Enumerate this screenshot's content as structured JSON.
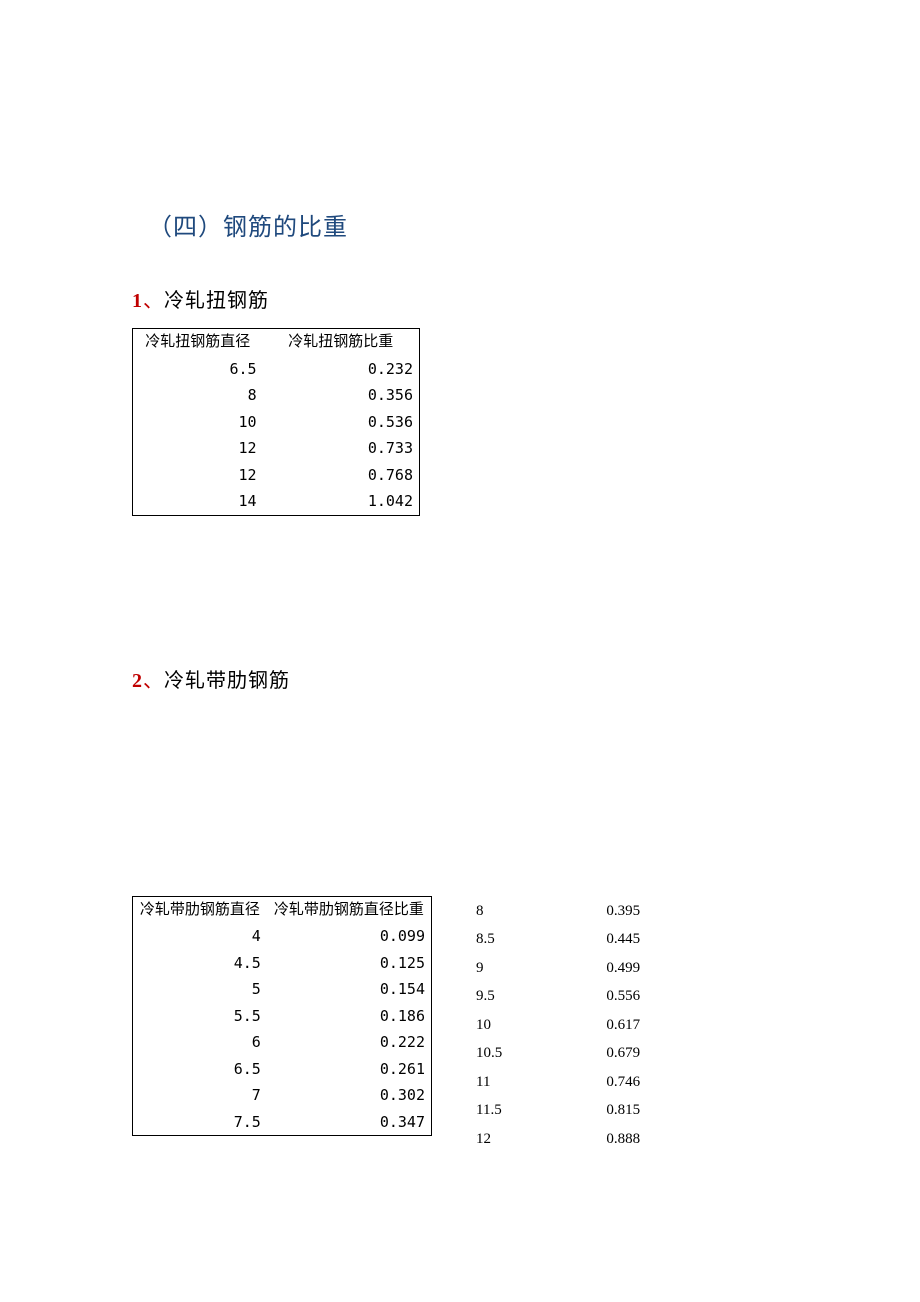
{
  "section_title": "（四）钢筋的比重",
  "sub1": {
    "num": "1",
    "sep": "、",
    "label": "冷轧扭钢筋",
    "headers": [
      "冷轧扭钢筋直径",
      "冷轧扭钢筋比重"
    ],
    "rows": [
      {
        "d": "6.5",
        "w": "0.232"
      },
      {
        "d": "8",
        "w": "0.356"
      },
      {
        "d": "10",
        "w": "0.536"
      },
      {
        "d": "12",
        "w": "0.733"
      },
      {
        "d": "12",
        "w": "0.768"
      },
      {
        "d": "14",
        "w": "1.042"
      }
    ]
  },
  "sub2": {
    "num": "2",
    "sep": "、",
    "label": "冷轧带肋钢筋",
    "headers": [
      "冷轧带肋钢筋直径",
      "冷轧带肋钢筋直径比重"
    ],
    "rows_left": [
      {
        "d": "4",
        "w": "0.099"
      },
      {
        "d": "4.5",
        "w": "0.125"
      },
      {
        "d": "5",
        "w": "0.154"
      },
      {
        "d": "5.5",
        "w": "0.186"
      },
      {
        "d": "6",
        "w": "0.222"
      },
      {
        "d": "6.5",
        "w": "0.261"
      },
      {
        "d": "7",
        "w": "0.302"
      },
      {
        "d": "7.5",
        "w": "0.347"
      }
    ],
    "rows_right": [
      {
        "d": "8",
        "w": "0.395"
      },
      {
        "d": "8.5",
        "w": "0.445"
      },
      {
        "d": "9",
        "w": "0.499"
      },
      {
        "d": "9.5",
        "w": "0.556"
      },
      {
        "d": "10",
        "w": "0.617"
      },
      {
        "d": "10.5",
        "w": "0.679"
      },
      {
        "d": "11",
        "w": "0.746"
      },
      {
        "d": "11.5",
        "w": "0.815"
      },
      {
        "d": "12",
        "w": "0.888"
      }
    ]
  }
}
